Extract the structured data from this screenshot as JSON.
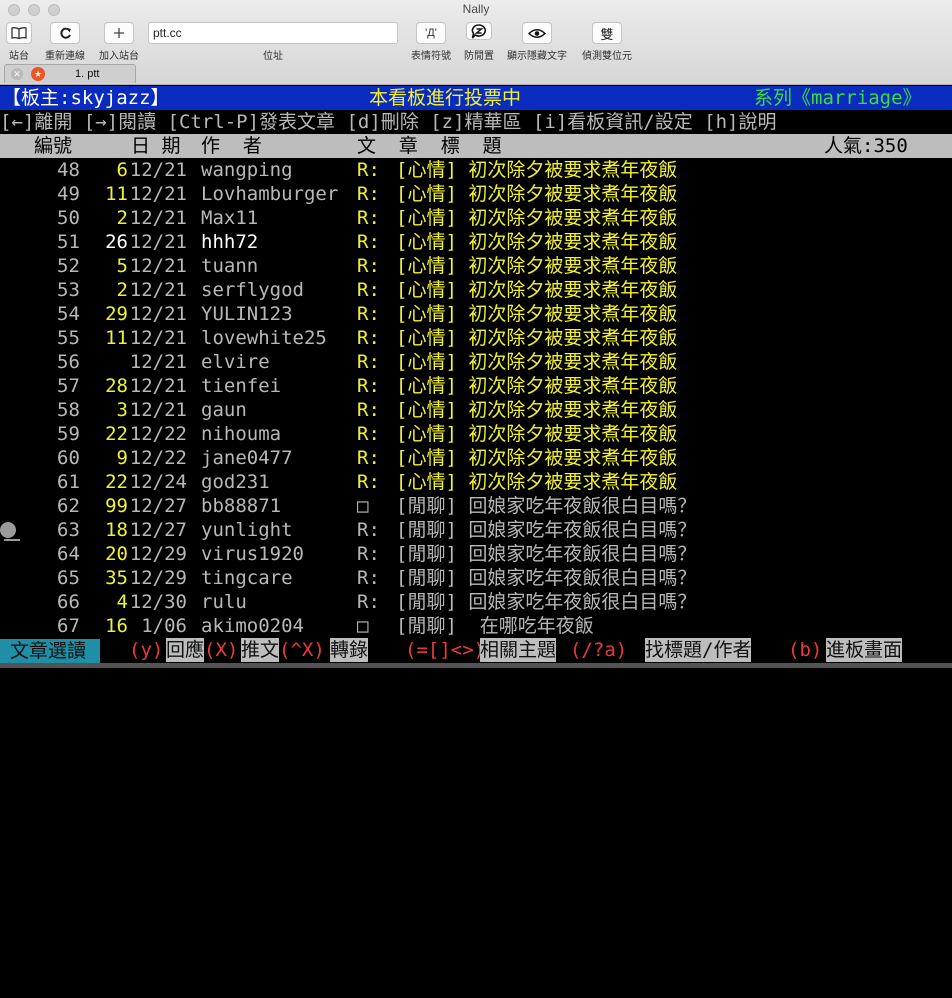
{
  "window": {
    "title": "Nally"
  },
  "toolbar": {
    "site_label": "站台",
    "reconnect_label": "重新連線",
    "add_site_label": "加入站台",
    "address_label": "位址",
    "url_value": "ptt.cc",
    "emoticon_label": "表情符號",
    "anti_idle_label": "防閒置",
    "show_hidden_label": "顯示隱藏文字",
    "detect_double_label": "偵測雙位元",
    "double_glyph": "雙",
    "emoticon_glyph": "'Д'"
  },
  "tab": {
    "title": "1. ptt"
  },
  "board": {
    "moderator": "【板主:skyjazz】",
    "vote_notice": "本看板進行投票中",
    "series": "系列《marriage》",
    "menu": "[←]離開 [→]閱讀 [Ctrl-P]發表文章 [d]刪除 [z]精華區 [i]看板資訊/設定 [h]說明",
    "col_number": "編號",
    "col_date": "日 期",
    "col_author": "作  者",
    "col_title": "文  章  標  題",
    "popularity": "人氣:350"
  },
  "posts": [
    {
      "num": "48",
      "count": "6",
      "date": "12/21",
      "author": "wangping",
      "mark": "R:",
      "title": "[心情] 初次除夕被要求煮年夜飯",
      "style": "y"
    },
    {
      "num": "49",
      "count": "11",
      "date": "12/21",
      "author": "Lovhamburger",
      "mark": "R:",
      "title": "[心情] 初次除夕被要求煮年夜飯",
      "style": "y"
    },
    {
      "num": "50",
      "count": "2",
      "date": "12/21",
      "author": "Max11",
      "mark": "R:",
      "title": "[心情] 初次除夕被要求煮年夜飯",
      "style": "y"
    },
    {
      "num": "51",
      "count": "26",
      "date": "12/21",
      "author": "hhh72",
      "mark": "R:",
      "title": "[心情] 初次除夕被要求煮年夜飯",
      "style": "y",
      "white": true
    },
    {
      "num": "52",
      "count": "5",
      "date": "12/21",
      "author": "tuann",
      "mark": "R:",
      "title": "[心情] 初次除夕被要求煮年夜飯",
      "style": "y"
    },
    {
      "num": "53",
      "count": "2",
      "date": "12/21",
      "author": "serflygod",
      "mark": "R:",
      "title": "[心情] 初次除夕被要求煮年夜飯",
      "style": "y"
    },
    {
      "num": "54",
      "count": "29",
      "date": "12/21",
      "author": "YULIN123",
      "mark": "R:",
      "title": "[心情] 初次除夕被要求煮年夜飯",
      "style": "y"
    },
    {
      "num": "55",
      "count": "11",
      "date": "12/21",
      "author": "lovewhite25",
      "mark": "R:",
      "title": "[心情] 初次除夕被要求煮年夜飯",
      "style": "y"
    },
    {
      "num": "56",
      "count": "",
      "date": "12/21",
      "author": "elvire",
      "mark": "R:",
      "title": "[心情] 初次除夕被要求煮年夜飯",
      "style": "y"
    },
    {
      "num": "57",
      "count": "28",
      "date": "12/21",
      "author": "tienfei",
      "mark": "R:",
      "title": "[心情] 初次除夕被要求煮年夜飯",
      "style": "y"
    },
    {
      "num": "58",
      "count": "3",
      "date": "12/21",
      "author": "gaun",
      "mark": "R:",
      "title": "[心情] 初次除夕被要求煮年夜飯",
      "style": "y"
    },
    {
      "num": "59",
      "count": "22",
      "date": "12/22",
      "author": "nihouma",
      "mark": "R:",
      "title": "[心情] 初次除夕被要求煮年夜飯",
      "style": "y"
    },
    {
      "num": "60",
      "count": "9",
      "date": "12/22",
      "author": "jane0477",
      "mark": "R:",
      "title": "[心情] 初次除夕被要求煮年夜飯",
      "style": "y"
    },
    {
      "num": "61",
      "count": "22",
      "date": "12/24",
      "author": "god231",
      "mark": "R:",
      "title": "[心情] 初次除夕被要求煮年夜飯",
      "style": "y"
    },
    {
      "num": "62",
      "count": "99",
      "date": "12/27",
      "author": "bb88871",
      "mark": "□",
      "title": "[閒聊] 回娘家吃年夜飯很白目嗎？",
      "style": "g"
    },
    {
      "num": "63",
      "count": "18",
      "date": "12/27",
      "author": "yunlight",
      "mark": "R:",
      "title": "[閒聊] 回娘家吃年夜飯很白目嗎？",
      "style": "g"
    },
    {
      "num": "64",
      "count": "20",
      "date": "12/29",
      "author": "virus1920",
      "mark": "R:",
      "title": "[閒聊] 回娘家吃年夜飯很白目嗎？",
      "style": "g"
    },
    {
      "num": "65",
      "count": "35",
      "date": "12/29",
      "author": "tingcare",
      "mark": "R:",
      "title": "[閒聊] 回娘家吃年夜飯很白目嗎？",
      "style": "g"
    },
    {
      "num": "66",
      "count": "4",
      "date": "12/30",
      "author": "rulu",
      "mark": "R:",
      "title": "[閒聊] 回娘家吃年夜飯很白目嗎？",
      "style": "g"
    },
    {
      "num": "67",
      "count": "16",
      "date": "1/06",
      "author": "akimo0204",
      "mark": "□",
      "title": "[閒聊]  在哪吃年夜飯",
      "style": "g"
    }
  ],
  "footer": {
    "mode": "文章選讀",
    "k1": "(y)",
    "t1": "回應",
    "k2": "(X)",
    "t2": "推文",
    "k3": "(^X)",
    "t3": "轉錄",
    "k4": "(=[]<>)",
    "t4": "相關主題",
    "k5": "(/?a)",
    "t5": "找標題/作者",
    "k6": "(b)",
    "t6": "進板畫面"
  },
  "colors": {
    "header_bg": "#0a2bbf",
    "yellow": "#f2f233",
    "green": "#3cdc3c",
    "footer_mode_bg": "#1f8fa8",
    "footer_key": "#e83b3b"
  }
}
